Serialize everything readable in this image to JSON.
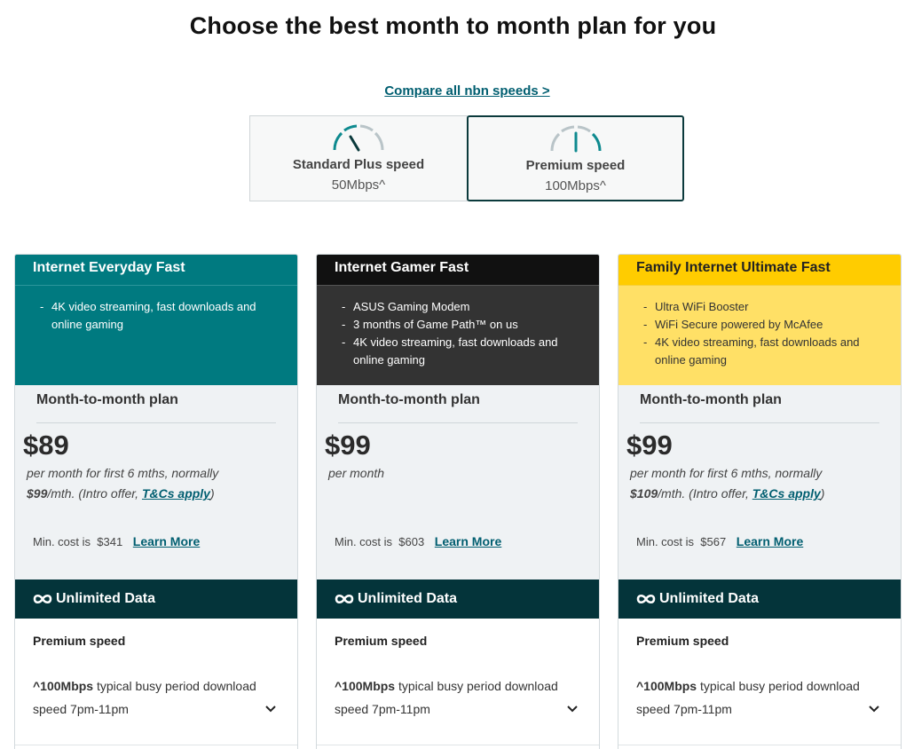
{
  "page": {
    "title": "Choose the best month to month plan for you",
    "compare_link": "Compare all nbn speeds >"
  },
  "speed_toggle": {
    "options": [
      {
        "name": "Standard Plus speed",
        "value": "50Mbps^",
        "selected": false,
        "icon": "speedometer-icon"
      },
      {
        "name": "Premium speed",
        "value": "100Mbps^",
        "selected": true,
        "icon": "speedometer-icon"
      }
    ]
  },
  "plans": [
    {
      "title": "Internet Everyday Fast",
      "features": [
        "4K video streaming, fast downloads and online gaming"
      ],
      "plan_type": "Month-to-month plan",
      "price": "$89",
      "price_note_1": "per month for first 6 mths, normally",
      "normal_price": "$99",
      "price_note_2": "/mth. (Intro offer, ",
      "tcs": "T&Cs apply",
      "price_note_3": ")",
      "min_cost_label": "Min. cost is",
      "min_cost": "$341",
      "learn_more": "Learn More",
      "data_label": "Unlimited Data",
      "speed_title": "Premium speed",
      "speed_value": "^100Mbps",
      "speed_desc": " typical busy period download speed 7pm-11pm"
    },
    {
      "title": "Internet Gamer Fast",
      "features": [
        "ASUS Gaming Modem",
        "3 months of Game Path™ on us",
        "4K video streaming, fast downloads and online gaming"
      ],
      "plan_type": "Month-to-month plan",
      "price": "$99",
      "price_note_1": "per month",
      "min_cost_label": "Min. cost is",
      "min_cost": "$603",
      "learn_more": "Learn More",
      "data_label": "Unlimited Data",
      "speed_title": "Premium speed",
      "speed_value": "^100Mbps",
      "speed_desc": " typical busy period download speed 7pm-11pm"
    },
    {
      "title": "Family Internet Ultimate Fast",
      "features": [
        "Ultra WiFi Booster",
        "WiFi Secure powered by McAfee",
        "4K video streaming, fast downloads and online gaming"
      ],
      "plan_type": "Month-to-month plan",
      "price": "$99",
      "price_note_1": "per month for first 6 mths, normally",
      "normal_price": "$109",
      "price_note_2": "/mth. (Intro offer, ",
      "tcs": "T&Cs apply",
      "price_note_3": ")",
      "min_cost_label": "Min. cost is",
      "min_cost": "$567",
      "learn_more": "Learn More",
      "data_label": "Unlimited Data",
      "speed_title": "Premium speed",
      "speed_value": "^100Mbps",
      "speed_desc": " typical busy period download speed 7pm-11pm"
    }
  ],
  "colors": {
    "teal": "#007a80",
    "dark_teal": "#04343a",
    "link": "#005e70",
    "gamer_head": "#111111",
    "gamer_body": "#333333",
    "family_head": "#ffcc00",
    "family_body": "#ffe066"
  }
}
